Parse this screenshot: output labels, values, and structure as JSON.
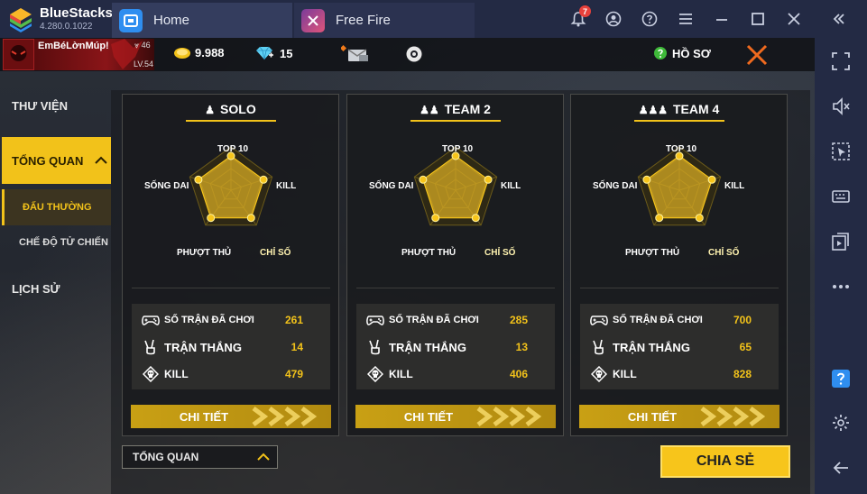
{
  "app": {
    "name": "BlueStacks",
    "version": "4.280.0.1022"
  },
  "tabs": [
    {
      "label": "Home",
      "icon": "home-icon"
    },
    {
      "label": "Free Fire",
      "icon": "free-fire-icon"
    }
  ],
  "titlebar": {
    "notification_count": "7",
    "icons": [
      "bell-icon",
      "account-icon",
      "help-icon",
      "menu-icon",
      "minimize-icon",
      "maximize-icon",
      "close-icon",
      "collapse-sidebar-icon"
    ]
  },
  "game_topbar": {
    "player_name": "EmBéLờnMúp!",
    "rank": "46",
    "level": "LV.54",
    "gold": "9.988",
    "diamonds": "15",
    "profile_label": "HỒ SƠ"
  },
  "left_menu": {
    "library": "THƯ VIỆN",
    "overview": "TỔNG QUAN",
    "ranked": "ĐẤU THƯỜNG",
    "battle_royale": "CHẾ ĐỘ TỬ CHIẾN",
    "history": "LỊCH SỬ"
  },
  "radar_labels": {
    "top": "TOP 10",
    "left": "SỐNG DAI",
    "right": "KILL",
    "bottom_left": "PHƯỢT THỦ",
    "bottom_right": "CHỈ SỐ"
  },
  "stat_labels": {
    "matches": "SỐ TRẬN ĐÃ CHƠI",
    "wins": "TRẬN THẮNG",
    "kills": "KILL"
  },
  "cards": [
    {
      "title": "SOLO",
      "matches": "261",
      "wins": "14",
      "kills": "479",
      "button": "CHI TIẾT"
    },
    {
      "title": "TEAM 2",
      "matches": "285",
      "wins": "13",
      "kills": "406",
      "button": "CHI TIẾT"
    },
    {
      "title": "TEAM 4",
      "matches": "700",
      "wins": "65",
      "kills": "828",
      "button": "CHI TIẾT"
    }
  ],
  "bottom": {
    "dropdown_value": "TỔNG QUAN",
    "share_button": "CHIA SẺ"
  },
  "right_sidebar_icons": [
    "fullscreen-icon",
    "volume-mute-icon",
    "pointer-icon",
    "keyboard-icon",
    "media-icon",
    "more-icon",
    "help-icon",
    "settings-icon",
    "back-icon"
  ],
  "colors": {
    "chrome": "#232a44",
    "accent_gold": "#f2c21a",
    "badge_red": "#e8413b"
  }
}
